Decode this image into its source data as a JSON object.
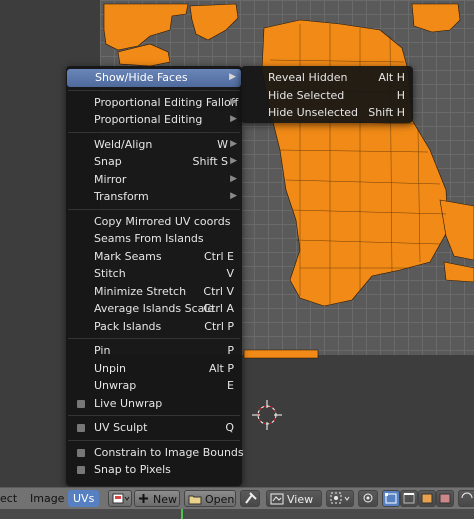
{
  "menu": {
    "items": [
      {
        "label": "Show/Hide Faces",
        "shortcut": "",
        "submenu": true,
        "active": true
      },
      {
        "sep": true
      },
      {
        "label": "Proportional Editing Falloff",
        "shortcut": "",
        "submenu": true
      },
      {
        "label": "Proportional Editing",
        "shortcut": "",
        "submenu": true
      },
      {
        "sep": true
      },
      {
        "label": "Weld/Align",
        "shortcut": "W",
        "submenu": true
      },
      {
        "label": "Snap",
        "shortcut": "Shift S",
        "submenu": true
      },
      {
        "label": "Mirror",
        "shortcut": "",
        "submenu": true
      },
      {
        "label": "Transform",
        "shortcut": "",
        "submenu": true
      },
      {
        "sep": true
      },
      {
        "label": "Copy Mirrored UV coords",
        "shortcut": ""
      },
      {
        "label": "Seams From Islands",
        "shortcut": ""
      },
      {
        "label": "Mark Seams",
        "shortcut": "Ctrl E"
      },
      {
        "label": "Stitch",
        "shortcut": "V"
      },
      {
        "label": "Minimize Stretch",
        "shortcut": "Ctrl V"
      },
      {
        "label": "Average Islands Scale",
        "shortcut": "Ctrl A"
      },
      {
        "label": "Pack Islands",
        "shortcut": "Ctrl P"
      },
      {
        "sep": true
      },
      {
        "label": "Pin",
        "shortcut": "P"
      },
      {
        "label": "Unpin",
        "shortcut": "Alt P"
      },
      {
        "label": "Unwrap",
        "shortcut": "E"
      },
      {
        "label": "Live Unwrap",
        "shortcut": "",
        "checkbox": true
      },
      {
        "sep": true
      },
      {
        "label": "UV Sculpt",
        "shortcut": "Q",
        "checkbox": true
      },
      {
        "sep": true
      },
      {
        "label": "Constrain to Image Bounds",
        "shortcut": "",
        "checkbox": true
      },
      {
        "label": "Snap to Pixels",
        "shortcut": "",
        "checkbox": true
      }
    ]
  },
  "submenu": {
    "items": [
      {
        "label": "Reveal Hidden",
        "shortcut": "Alt H"
      },
      {
        "label": "Hide Selected",
        "shortcut": "H"
      },
      {
        "label": "Hide Unselected",
        "shortcut": "Shift H"
      }
    ]
  },
  "header": {
    "select_label": "ect",
    "image_label": "Image",
    "uvs_label": "UVs",
    "new_label": "New",
    "open_label": "Open",
    "view_label": "View"
  },
  "colors": {
    "accent": "#5680c2",
    "uv_edge": "#ff8c00",
    "menu_bg": "#141414"
  }
}
